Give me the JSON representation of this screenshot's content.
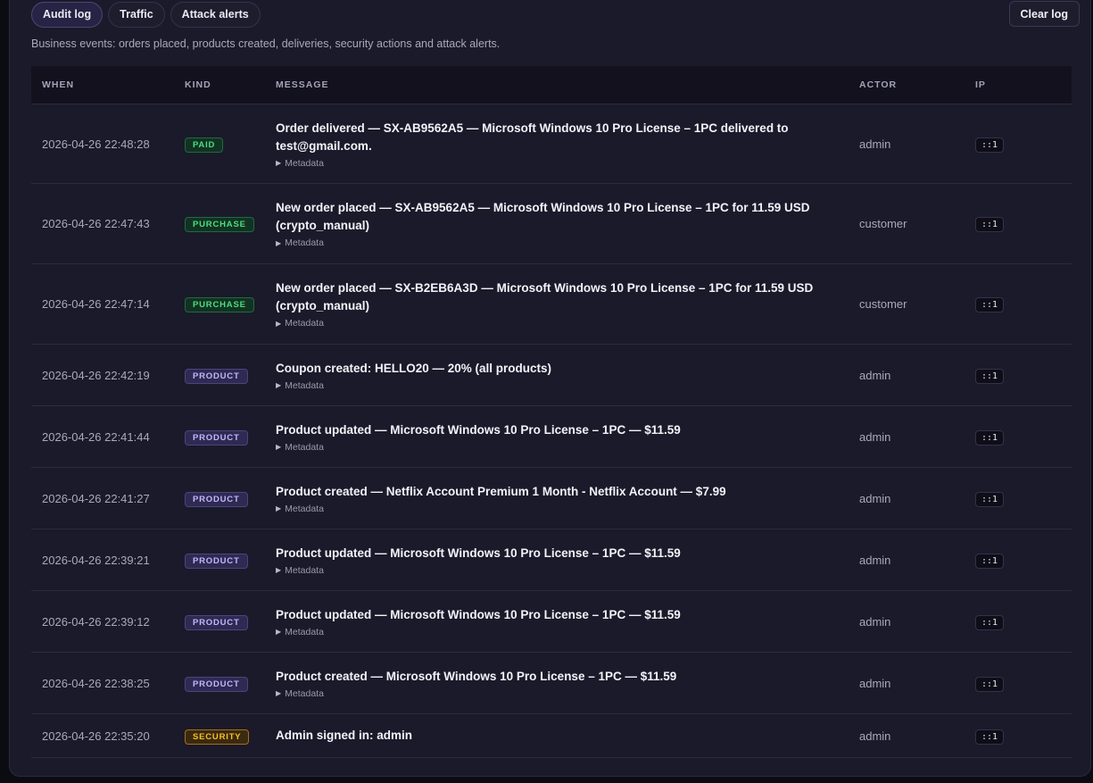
{
  "tabs": [
    {
      "label": "Audit log",
      "active": true
    },
    {
      "label": "Traffic",
      "active": false
    },
    {
      "label": "Attack alerts",
      "active": false
    }
  ],
  "clear_label": "Clear log",
  "description": "Business events: orders placed, products created, deliveries, security actions and attack alerts.",
  "columns": {
    "when": "WHEN",
    "kind": "KIND",
    "message": "MESSAGE",
    "actor": "ACTOR",
    "ip": "IP"
  },
  "metadata_label": "Metadata",
  "rows": [
    {
      "when": "2026-04-26 22:48:28",
      "kind": "PAID",
      "kind_class": "paid",
      "message_line1": "Order delivered — SX-AB9562A5 — Microsoft Windows 10 Pro License – 1PC delivered to",
      "message_line2": "test@gmail.com.",
      "has_meta": true,
      "actor": "admin",
      "ip": "::1"
    },
    {
      "when": "2026-04-26 22:47:43",
      "kind": "PURCHASE",
      "kind_class": "purchase",
      "message_line1": "New order placed — SX-AB9562A5 — Microsoft Windows 10 Pro License – 1PC for 11.59 USD",
      "message_line2": "(crypto_manual)",
      "has_meta": true,
      "actor": "customer",
      "ip": "::1"
    },
    {
      "when": "2026-04-26 22:47:14",
      "kind": "PURCHASE",
      "kind_class": "purchase",
      "message_line1": "New order placed — SX-B2EB6A3D — Microsoft Windows 10 Pro License – 1PC for 11.59 USD",
      "message_line2": "(crypto_manual)",
      "has_meta": true,
      "actor": "customer",
      "ip": "::1"
    },
    {
      "when": "2026-04-26 22:42:19",
      "kind": "PRODUCT",
      "kind_class": "product",
      "message_line1": "Coupon created: HELLO20 — 20% (all products)",
      "message_line2": "",
      "has_meta": true,
      "actor": "admin",
      "ip": "::1"
    },
    {
      "when": "2026-04-26 22:41:44",
      "kind": "PRODUCT",
      "kind_class": "product",
      "message_line1": "Product updated — Microsoft Windows 10 Pro License – 1PC — $11.59",
      "message_line2": "",
      "has_meta": true,
      "actor": "admin",
      "ip": "::1"
    },
    {
      "when": "2026-04-26 22:41:27",
      "kind": "PRODUCT",
      "kind_class": "product",
      "message_line1": "Product created — Netflix Account Premium 1 Month - Netflix Account — $7.99",
      "message_line2": "",
      "has_meta": true,
      "actor": "admin",
      "ip": "::1"
    },
    {
      "when": "2026-04-26 22:39:21",
      "kind": "PRODUCT",
      "kind_class": "product",
      "message_line1": "Product updated — Microsoft Windows 10 Pro License – 1PC — $11.59",
      "message_line2": "",
      "has_meta": true,
      "actor": "admin",
      "ip": "::1"
    },
    {
      "when": "2026-04-26 22:39:12",
      "kind": "PRODUCT",
      "kind_class": "product",
      "message_line1": "Product updated — Microsoft Windows 10 Pro License – 1PC — $11.59",
      "message_line2": "",
      "has_meta": true,
      "actor": "admin",
      "ip": "::1"
    },
    {
      "when": "2026-04-26 22:38:25",
      "kind": "PRODUCT",
      "kind_class": "product",
      "message_line1": "Product created — Microsoft Windows 10 Pro License – 1PC — $11.59",
      "message_line2": "",
      "has_meta": true,
      "actor": "admin",
      "ip": "::1"
    },
    {
      "when": "2026-04-26 22:35:20",
      "kind": "SECURITY",
      "kind_class": "security",
      "message_line1": "Admin signed in: admin",
      "message_line2": "",
      "has_meta": false,
      "actor": "admin",
      "ip": "::1"
    }
  ],
  "colors": {
    "panel_bg": "#1b1a2a",
    "header_bg": "#12111d",
    "paid": "#4ade80",
    "product": "#c4b5fd",
    "security": "#fbbf24"
  }
}
